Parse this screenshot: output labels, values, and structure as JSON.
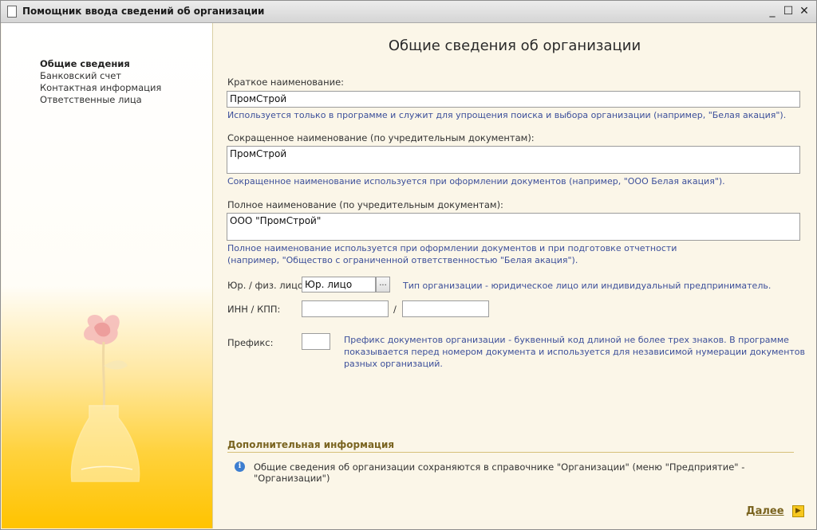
{
  "window": {
    "title": "Помощник ввода сведений об организации",
    "minimize": "_",
    "maximize": "☐",
    "close": "✕"
  },
  "nav": {
    "items": [
      {
        "label": "Общие сведения",
        "active": true
      },
      {
        "label": "Банковский счет",
        "active": false
      },
      {
        "label": "Контактная информация",
        "active": false
      },
      {
        "label": "Ответственные лица",
        "active": false
      }
    ]
  },
  "main": {
    "heading": "Общие сведения об организации",
    "short_name": {
      "label": "Краткое наименование:",
      "value": "ПромСтрой",
      "hint": "Используется только в программе и служит для упрощения поиска и выбора организации (например, \"Белая акация\")."
    },
    "abbr_name": {
      "label": "Сокращенное наименование (по учредительным документам):",
      "value": "ПромСтрой",
      "hint": "Сокращенное наименование используется при оформлении документов (например, \"ООО Белая акация\")."
    },
    "full_name": {
      "label": "Полное наименование (по учредительным документам):",
      "value": "ООО \"ПромСтрой\"",
      "hint_line1": "Полное наименование используется при оформлении документов и при подготовке отчетности",
      "hint_line2": "(например, \"Общество с ограниченной ответственностью \"Белая акация\")."
    },
    "entity_type": {
      "label": "Юр. / физ. лицо:",
      "value": "Юр. лицо",
      "button": "...",
      "hint": "Тип организации - юридическое лицо или индивидуальный предприниматель."
    },
    "inn_kpp": {
      "label": "ИНН / КПП:",
      "separator": "/",
      "inn": "",
      "kpp": ""
    },
    "prefix": {
      "label": "Префикс:",
      "value": "",
      "hint_line1": "Префикс документов организации - буквенный код длиной не более трех знаков. В программе",
      "hint_line2": "показывается перед номером документа и используется для независимой нумерации документов",
      "hint_line3": "разных организаций."
    },
    "additional": {
      "title": "Дополнительная информация",
      "text": "Общие сведения об организации сохраняются в справочнике \"Организации\" (меню \"Предприятие\" - \"Организации\")"
    },
    "next_label": "Далее"
  }
}
